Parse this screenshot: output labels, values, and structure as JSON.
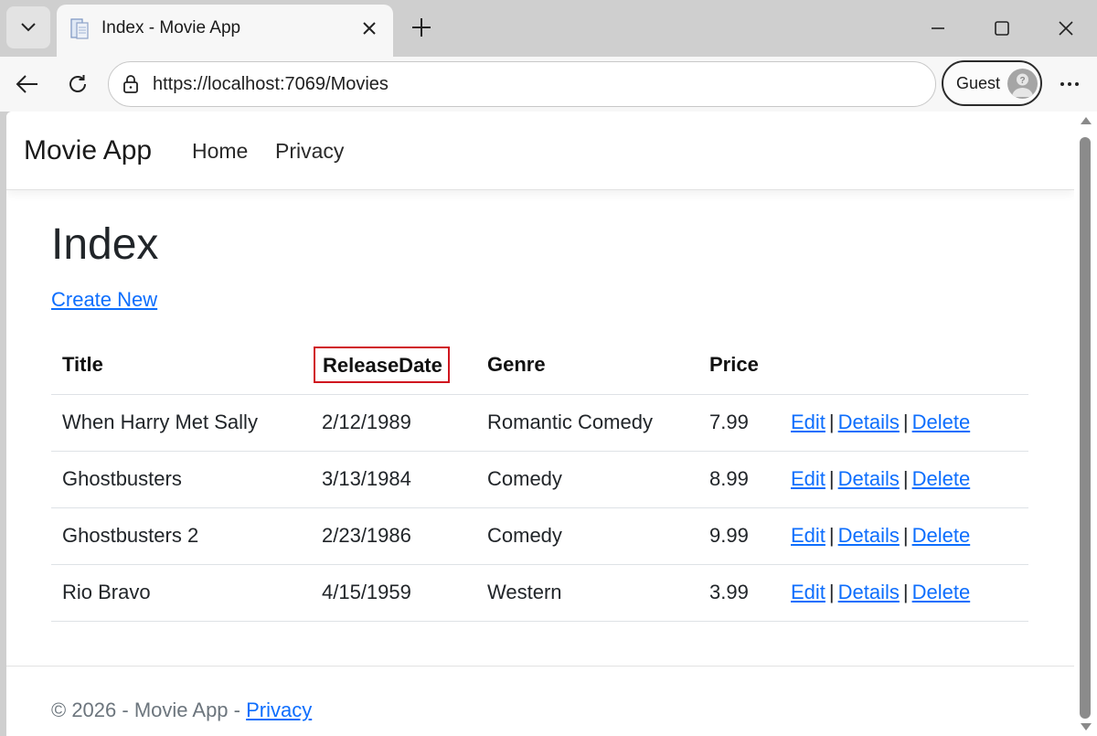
{
  "browser": {
    "tab_title": "Index - Movie App",
    "url": "https://localhost:7069/Movies",
    "profile_label": "Guest"
  },
  "site": {
    "brand": "Movie App",
    "nav": [
      "Home",
      "Privacy"
    ]
  },
  "page": {
    "heading": "Index",
    "create_link": "Create New"
  },
  "table": {
    "headers": [
      "Title",
      "ReleaseDate",
      "Genre",
      "Price"
    ],
    "rows": [
      {
        "title": "When Harry Met Sally",
        "release_date": "2/12/1989",
        "genre": "Romantic Comedy",
        "price": "7.99"
      },
      {
        "title": "Ghostbusters",
        "release_date": "3/13/1984",
        "genre": "Comedy",
        "price": "8.99"
      },
      {
        "title": "Ghostbusters 2",
        "release_date": "2/23/1986",
        "genre": "Comedy",
        "price": "9.99"
      },
      {
        "title": "Rio Bravo",
        "release_date": "4/15/1959",
        "genre": "Western",
        "price": "3.99"
      }
    ],
    "actions": {
      "edit": "Edit",
      "details": "Details",
      "delete": "Delete",
      "separator": "|"
    }
  },
  "footer": {
    "text": "© 2026 - Movie App - ",
    "link": "Privacy"
  },
  "colors": {
    "link": "#0d6efd",
    "highlight_border": "#d0161f"
  }
}
